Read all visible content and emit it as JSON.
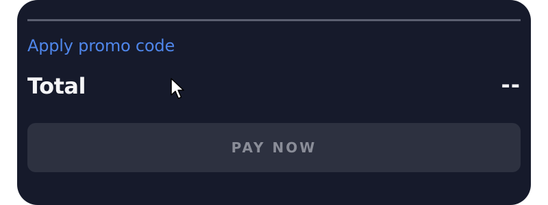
{
  "checkout": {
    "promo_link": "Apply promo code",
    "total_label": "Total",
    "total_value": "--",
    "pay_button": "PAY NOW"
  },
  "colors": {
    "panel_background": "#161a2b",
    "link": "#4f86ea",
    "button_background": "#2d3140",
    "button_text": "#8a8d98",
    "divider": "#5b5f70"
  },
  "icons": {
    "cursor": "mouse-pointer-icon"
  }
}
